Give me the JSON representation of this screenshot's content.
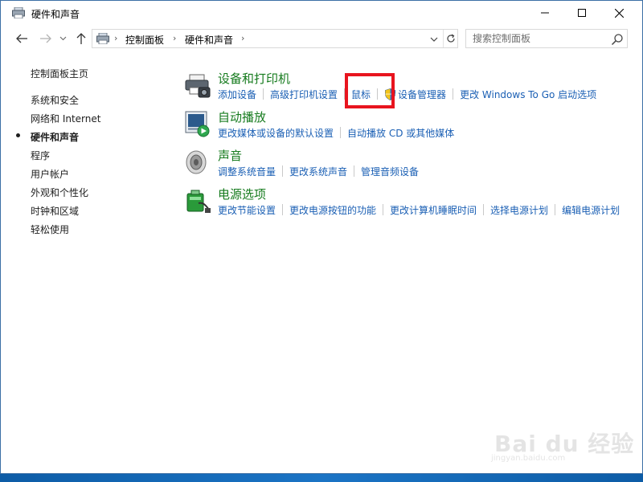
{
  "window": {
    "title": "硬件和声音"
  },
  "address": {
    "crumbs": [
      "控制面板",
      "硬件和声音"
    ]
  },
  "search": {
    "placeholder": "搜索控制面板"
  },
  "sidebar": {
    "items": [
      {
        "label": "控制面板主页",
        "current": false
      },
      {
        "label": "系统和安全",
        "current": false
      },
      {
        "label": "网络和 Internet",
        "current": false
      },
      {
        "label": "硬件和声音",
        "current": true
      },
      {
        "label": "程序",
        "current": false
      },
      {
        "label": "用户帐户",
        "current": false
      },
      {
        "label": "外观和个性化",
        "current": false
      },
      {
        "label": "时钟和区域",
        "current": false
      },
      {
        "label": "轻松使用",
        "current": false
      }
    ]
  },
  "categories": [
    {
      "title": "设备和打印机",
      "icon": "printer-icon",
      "links": [
        "添加设备",
        "高级打印机设置",
        "鼠标",
        "设备管理器",
        "更改 Windows To Go 启动选项"
      ]
    },
    {
      "title": "自动播放",
      "icon": "autoplay-icon",
      "links": [
        "更改媒体或设备的默认设置",
        "自动播放 CD 或其他媒体"
      ]
    },
    {
      "title": "声音",
      "icon": "speaker-icon",
      "links": [
        "调整系统音量",
        "更改系统声音",
        "管理音频设备"
      ]
    },
    {
      "title": "电源选项",
      "icon": "power-options-icon",
      "links": [
        "更改节能设置",
        "更改电源按钮的功能",
        "更改计算机睡眠时间",
        "选择电源计划",
        "编辑电源计划"
      ]
    }
  ],
  "watermark": {
    "main": "Bai du 经验",
    "sub": "jingyan.baidu.com"
  },
  "colors": {
    "link": "#1a5fb4",
    "category_title": "#167b1e",
    "highlight": "#e8141e"
  }
}
